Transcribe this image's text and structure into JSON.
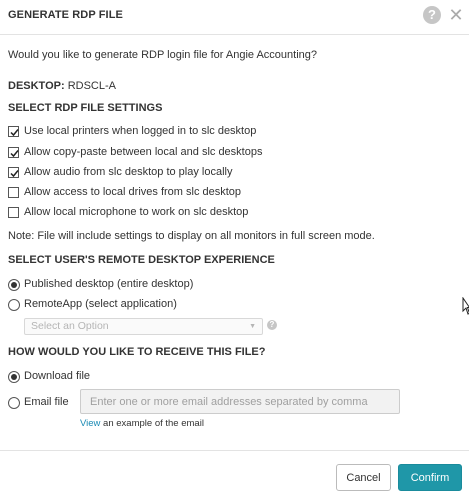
{
  "dialog": {
    "title": "GENERATE RDP FILE",
    "help_glyph": "?",
    "close_glyph": "✕"
  },
  "prompt": "Would you like to generate RDP login file for Angie Accounting?",
  "desktop": {
    "label": "DESKTOP:",
    "value": "RDSCL-A"
  },
  "settings": {
    "heading": "SELECT RDP FILE SETTINGS",
    "options": [
      {
        "label": "Use local printers when logged in to slc desktop",
        "checked": true
      },
      {
        "label": "Allow copy-paste between local and slc desktops",
        "checked": true
      },
      {
        "label": "Allow audio from slc desktop to play locally",
        "checked": true
      },
      {
        "label": "Allow access to local drives from slc desktop",
        "checked": false
      },
      {
        "label": "Allow local microphone to work on slc desktop",
        "checked": false
      }
    ],
    "note": "Note: File will include settings to display on all monitors in full screen mode."
  },
  "experience": {
    "heading": "SELECT USER'S REMOTE DESKTOP EXPERIENCE",
    "options": [
      {
        "label": "Published desktop (entire desktop)",
        "selected": true
      },
      {
        "label": "RemoteApp (select application)",
        "selected": false
      }
    ],
    "app_select": {
      "placeholder": "Select an Option",
      "arrow_glyph": "▼",
      "help_glyph": "?"
    }
  },
  "receive": {
    "heading": "HOW WOULD YOU LIKE TO RECEIVE THIS FILE?",
    "options": [
      {
        "label": "Download file",
        "selected": true
      },
      {
        "label": "Email file",
        "selected": false
      }
    ],
    "email_placeholder": "Enter one or more email addresses separated by comma",
    "view_link": "View",
    "view_suffix": " an example of the email"
  },
  "footer": {
    "cancel_label": "Cancel",
    "confirm_label": "Confirm"
  },
  "colors": {
    "accent": "#1f97a8",
    "link": "#1a8ab5"
  }
}
